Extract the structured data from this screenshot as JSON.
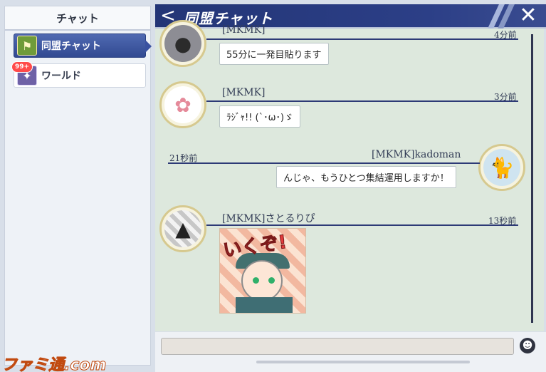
{
  "sidebar": {
    "title": "チャット",
    "items": [
      {
        "label": "同盟チャット",
        "icon": "guild-flag-icon",
        "active": true
      },
      {
        "label": "ワールド",
        "icon": "world-emblem-icon",
        "badge": "99+"
      }
    ]
  },
  "header": {
    "back_icon": "<",
    "title": "同盟チャット",
    "close_icon": "✕"
  },
  "messages": [
    {
      "name": "[MKMK]",
      "time": "4分前",
      "text": "55分に一発目貼ります",
      "avatar": "masked-face-avatar",
      "side": "left"
    },
    {
      "name": "[MKMK]",
      "time": "3分前",
      "text": "ﾗｼﾞｬ!! (`･ω･)ゞ",
      "avatar": "paw-avatar",
      "side": "left"
    },
    {
      "name": "[MKMK]kadoman",
      "time": "21秒前",
      "text": "んじゃ、もうひとつ集結運用しますか！",
      "avatar": "black-cat-avatar",
      "side": "right"
    },
    {
      "name": "[MKMK]さとるりぴ",
      "time": "13秒前",
      "sticker_text": "いくぞ!",
      "avatar": "onigiri-avatar",
      "side": "left"
    }
  ],
  "input": {
    "placeholder": "",
    "value": ""
  },
  "watermark": "ファミ通.com"
}
